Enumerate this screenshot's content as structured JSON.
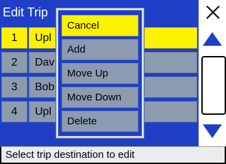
{
  "header": {
    "title": "Edit Trip",
    "close_icon": "close-x-icon"
  },
  "list": {
    "rows": [
      {
        "num": "1",
        "name": "Upl",
        "selected": true
      },
      {
        "num": "2",
        "name": "Dav",
        "selected": false
      },
      {
        "num": "3",
        "name": "Bob",
        "selected": false
      },
      {
        "num": "4",
        "name": "Upl",
        "selected": false
      }
    ]
  },
  "scrollbar": {
    "up_icon": "triangle-up-icon",
    "down_icon": "triangle-down-icon",
    "arrow_color": "#1f3fc7"
  },
  "popup": {
    "items": [
      {
        "label": "Cancel",
        "active": true
      },
      {
        "label": "Add",
        "active": false
      },
      {
        "label": "Move Up",
        "active": false
      },
      {
        "label": "Move Down",
        "active": false
      },
      {
        "label": "Delete",
        "active": false
      }
    ]
  },
  "status": {
    "text": "Select trip destination to edit"
  },
  "colors": {
    "accent_blue": "#1f3fc7",
    "highlight_yellow": "#fff200",
    "row_gray": "#8c9bb0"
  }
}
